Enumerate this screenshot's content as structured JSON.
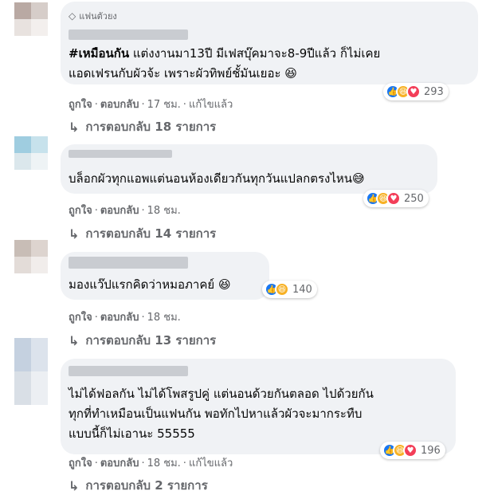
{
  "comments": [
    {
      "badge": "แฟนตัวยง",
      "lines_html": [
        "<b>#เหมือนกัน</b> แต่งงานมา13ปี มีเฟสบุ๊คมาจะ8-9ปีแล้ว ก็ไม่เคย",
        "แอดเฟรนกับผัวจ้ะ เพราะผัวทิพย์ชั้มันเยอะ 😆"
      ],
      "reaction_count": "293",
      "reactions": [
        "like",
        "haha",
        "love"
      ],
      "actions": [
        "ถูกใจ",
        "ตอบกลับ",
        "17 ชม.",
        "แก้ไขแล้ว"
      ],
      "replies": "การตอบกลับ 18 รายการ"
    },
    {
      "lines_html": [
        "บล็อกผัวทุกแอพแต่นอนห้องเดียวกันทุกวันแปลกตรงไหน😅"
      ],
      "reaction_count": "250",
      "reactions": [
        "like",
        "haha",
        "love"
      ],
      "actions": [
        "ถูกใจ",
        "ตอบกลับ",
        "18 ชม."
      ],
      "replies": "การตอบกลับ 14 รายการ"
    },
    {
      "lines_html": [
        "มองแว๊ปแรกคิดว่าหมอภาคย์ 😆"
      ],
      "reaction_count": "140",
      "reactions": [
        "like",
        "haha"
      ],
      "actions": [
        "ถูกใจ",
        "ตอบกลับ",
        "18 ชม."
      ],
      "replies": "การตอบกลับ 13 รายการ"
    },
    {
      "lines_html": [
        "ไม่ได้ฟอลกัน ไม่ได้โพสรูปคู่ แต่นอนด้วยกันตลอด ไปด้วยกัน",
        "ทุกที่ทำเหมือนเป็นแฟนกัน พอทักไปหาแล้วผัวจะมากระทืบ",
        "แบบนี้ก็ไม่เอานะ 55555"
      ],
      "reaction_count": "196",
      "reactions": [
        "like",
        "haha",
        "love"
      ],
      "actions": [
        "ถูกใจ",
        "ตอบกลับ",
        "18 ชม.",
        "แก้ไขแล้ว"
      ],
      "replies": "การตอบกลับ 2 รายการ"
    }
  ],
  "icons": {
    "badge_icon": "diamond-icon",
    "reply_icon": "reply-arrow-icon",
    "like_icon": "thumbs-up-icon",
    "haha_icon": "laughing-face-icon",
    "love_icon": "heart-icon"
  },
  "colors": {
    "bubble": "#f0f2f5",
    "meta_text": "#65676b",
    "like": "#1877f2",
    "haha": "#f7b125",
    "love": "#f33e58"
  }
}
